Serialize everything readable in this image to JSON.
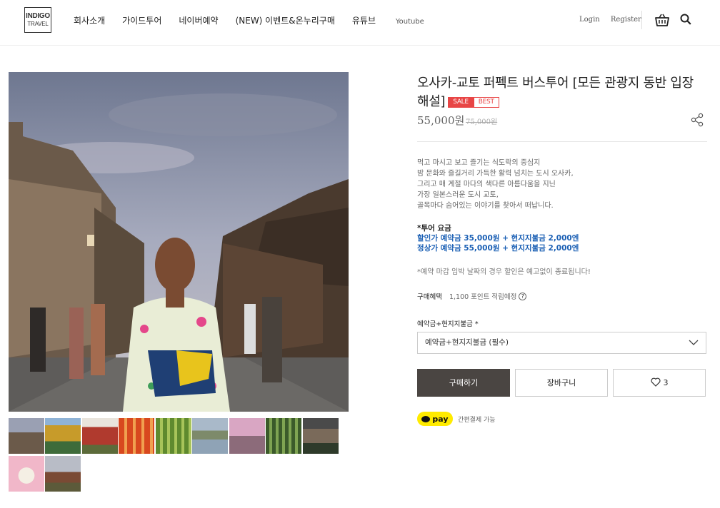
{
  "header": {
    "logo_line1": "INDIGO",
    "logo_line2": "TRAVEL",
    "nav": [
      "회사소개",
      "가이드투어",
      "네이버예약",
      "(NEW) 이벤트&온누리구매",
      "유튜브"
    ],
    "nav_youtube_small": "Youtube",
    "login": "Login",
    "register": "Register"
  },
  "product": {
    "title": "오사카-교토 퍼펙트 버스투어 [모든 관광지 동반 입장 해설]",
    "badge_sale": "SALE",
    "badge_best": "BEST",
    "price": "55,000원",
    "original_price": "75,000원",
    "description": [
      "먹고 마시고 보고 즐기는 식도락의 중심지",
      "밤 문화와 즐길거리 가득한 활력 넘치는 도시 오사카,",
      "그리고 매 계절 마다의 색다른 아름다움을 지닌",
      "가장 일본스러운 도시 교토,",
      "골목마다 숨어있는 이야기를 찾아서 떠납니다."
    ],
    "fee_heading": "*투어 요금",
    "fee_discount": "할인가 예약금 35,000원 + 현지지불금 2,000엔",
    "fee_regular": "정상가 예약금 55,000원 + 현지지불금 2,000엔",
    "notice": "*예약 마감 임박 날짜의 경우 할인은 예고없이 종료됩니다!",
    "benefit_label": "구매혜택",
    "benefit_points": "1,100 포인트 적립예정",
    "option_label": "예약금+현지지불금 *",
    "option_selected": "예약금+현지지불금 (필수)",
    "buy_label": "구매하기",
    "cart_label": "장바구니",
    "like_count": "3",
    "kakaopay_label": "pay",
    "kakaopay_text": "간편결제 가능"
  },
  "gallery": {
    "thumbnail_count": 11
  },
  "colors": {
    "sale_red": "#e84545",
    "fee_blue": "#1a5fb4",
    "buy_button": "#4a4542",
    "kakao_yellow": "#ffeb00"
  },
  "icons": [
    "basket-icon",
    "search-icon",
    "share-icon",
    "chevron-down-icon",
    "heart-icon",
    "help-icon"
  ]
}
